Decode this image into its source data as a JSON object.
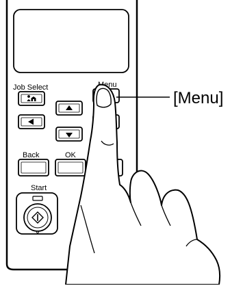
{
  "panel": {
    "job_select_label": "Job Select",
    "menu_label": "Menu",
    "back_label": "Back",
    "ok_label": "OK",
    "start_label": "Start"
  },
  "callout": {
    "label": "[Menu]"
  },
  "icons": {
    "job_select": "person-home-icon",
    "up": "triangle-up-icon",
    "left": "triangle-left-icon",
    "down": "triangle-down-icon",
    "start": "start-diamond-icon",
    "indicator": "start-indicator-dot"
  },
  "colors": {
    "stroke": "#000000",
    "background": "#ffffff"
  }
}
